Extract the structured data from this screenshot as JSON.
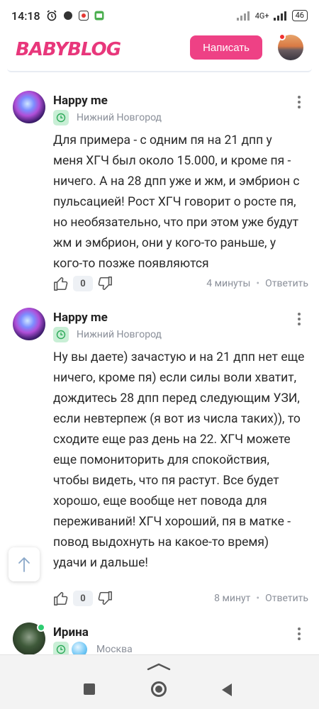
{
  "status": {
    "time": "14:18",
    "network": "4G+",
    "battery": "46"
  },
  "header": {
    "logo": "BABYBLOG",
    "write_label": "Написать"
  },
  "comments": [
    {
      "author": "Happy me",
      "city": "Нижний Новгород",
      "text": "Для примера - с одним пя на 21 дпп у меня ХГЧ был около 15.000, и кроме пя - ничего. А на 28 дпп уже и жм, и эмбрион с пульсацией! Рост ХГЧ говорит о росте пя, но необязательно, что при этом уже будут жм и эмбрион, они у кого-то раньше, у кого-то позже появляются",
      "likes": "0",
      "time": "4 минуты",
      "reply": "Ответить"
    },
    {
      "author": "Happy me",
      "city": "Нижний Новгород",
      "text": "Ну вы даете) зачастую и на 21 дпп нет еще ничего, кроме пя) если силы воли хватит, дождитесь 28 дпп перед следующим УЗИ, если невтерпеж (я вот из числа таких)), то сходите еще раз день на 22. ХГЧ можете еще помониторить для спокойствия, чтобы видеть, что пя растут. Все будет хорошо, еще вообще нет повода для переживаний! ХГЧ хороший, пя в матке - повод выдохнуть на какое-то время) удачи и дальше!",
      "likes": "0",
      "time": "8 минут",
      "reply": "Ответить"
    },
    {
      "author": "Ирина",
      "city": "Москва"
    }
  ],
  "colors": {
    "brand": "#e8377b",
    "button": "#ee4185",
    "muted": "#8a8f99"
  }
}
